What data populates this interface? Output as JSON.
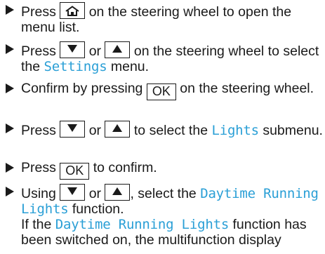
{
  "steps": [
    {
      "t1": "Press",
      "key": "home-icon",
      "t2": "on the steering wheel to open the menu list."
    },
    {
      "t1": "Press",
      "key1": "down-arrow-icon",
      "t_or": "or",
      "key2": "up-arrow-icon",
      "t2": "on the steering wheel to select the",
      "hl": "Settings",
      "t3": "menu."
    },
    {
      "t1": "Confirm by pressing",
      "key": "OK",
      "t2": "on the steering wheel."
    },
    {
      "t1": "Press",
      "key1": "down-arrow-icon",
      "t_or": "or",
      "key2": "up-arrow-icon",
      "t2": "to select the",
      "hl": "Lights",
      "t3": "submenu."
    },
    {
      "t1": "Press",
      "key": "OK",
      "t2": "to confirm."
    },
    {
      "t1": "Using",
      "key1": "down-arrow-icon",
      "t_or": "or",
      "key2": "up-arrow-icon",
      "t2": ", select the",
      "hl": "Daytime Running Lights",
      "t3": "function.",
      "cont1": "If the",
      "cont_hl": "Daytime Running Lights",
      "cont2": "function has been switched on, the multifunction display"
    }
  ],
  "colors": {
    "highlight": "#2a9fd6",
    "text": "#1a1a1a"
  }
}
